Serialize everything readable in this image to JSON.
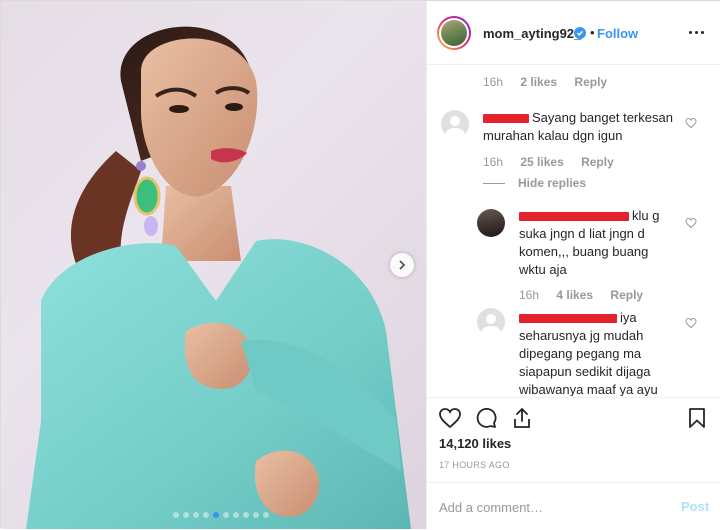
{
  "post": {
    "image_alt": "Portrait photo of a woman in a light turquoise sparkly dress with a side ponytail and jeweled earrings against a pale pink backdrop",
    "carousel": {
      "total": 10,
      "active_index": 4
    }
  },
  "header": {
    "username": "mom_ayting92_",
    "separator": "•",
    "follow_label": "Follow"
  },
  "comments": [
    {
      "id": "c0",
      "meta": {
        "time": "16h",
        "likes": "2 likes",
        "reply": "Reply"
      }
    },
    {
      "id": "c1",
      "text": "Sayang banget terkesan murahan kalau dgn igun",
      "text_line1": "Sayang banget terkesan",
      "text_line2": "murahan kalau dgn igun",
      "meta": {
        "time": "16h",
        "likes": "25 likes",
        "reply": "Reply"
      },
      "hide_replies_label": "Hide replies"
    },
    {
      "id": "r1",
      "text_line1": "klu g",
      "text_line2": "suka jngn d liat jngn d",
      "text_line3": "komen,,, buang buang",
      "text_line4": "wktu aja",
      "meta": {
        "time": "16h",
        "likes": "4 likes",
        "reply": "Reply"
      }
    },
    {
      "id": "r2",
      "text_line1": "iya",
      "text_line2": "seharusnya jg mudah",
      "text_line3": "dipegang pegang ma",
      "text_line4": "siapapun sedikit dijaga",
      "text_line5": "wibawanya maaf ya ayu"
    }
  ],
  "actions": {
    "likes_count": "14,120 likes",
    "posted_ago": "17 HOURS AGO"
  },
  "composer": {
    "placeholder": "Add a comment…",
    "post_label": "Post"
  },
  "colors": {
    "accent": "#3897f0",
    "muted_text": "#999999",
    "redaction": "#e3222b",
    "dress": "#7fd6d2",
    "backdrop": "#e8dfe8"
  },
  "icons": {
    "like": "heart-icon",
    "comment": "comment-icon",
    "share": "share-icon",
    "save": "bookmark-icon",
    "more": "more-options-icon",
    "verified": "verified-badge-icon",
    "next": "chevron-right-icon"
  }
}
